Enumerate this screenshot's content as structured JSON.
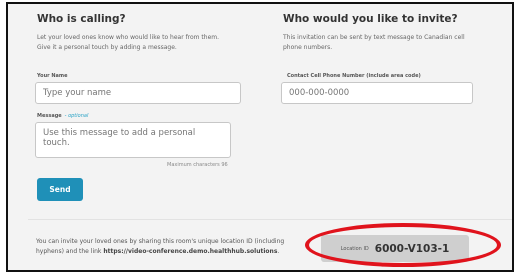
{
  "left": {
    "heading": "Who is calling?",
    "description_line1": "Let your loved ones know who would like to hear from them.",
    "description_line2": "Give it a personal touch by adding a message.",
    "name_label": "Your Name",
    "name_placeholder": "Type your name",
    "message_label": "Message",
    "message_optional": "- optional",
    "message_placeholder": "Use this message to add a personal touch.",
    "max_chars": "Maximum characters 96",
    "send_label": "Send"
  },
  "right": {
    "heading": "Who would you like to invite?",
    "description_line1": "This invitation can be sent by text message to Canadian cell",
    "description_line2": "phone numbers.",
    "phone_label": "Contact Cell Phone Number (include area code)",
    "phone_placeholder": "000-000-0000"
  },
  "footer": {
    "info_text_1": "You can invite your loved ones by sharing this room's unique location ID (including",
    "info_text_2": "hyphens) and the link",
    "info_link": "https://video-conference.demo.healthhub.solutions",
    "info_end": ".",
    "location_label": "Location ID",
    "location_value": "6000-V103-1"
  },
  "colors": {
    "accent": "#1f90b8",
    "highlight_ring": "#e0131c"
  }
}
